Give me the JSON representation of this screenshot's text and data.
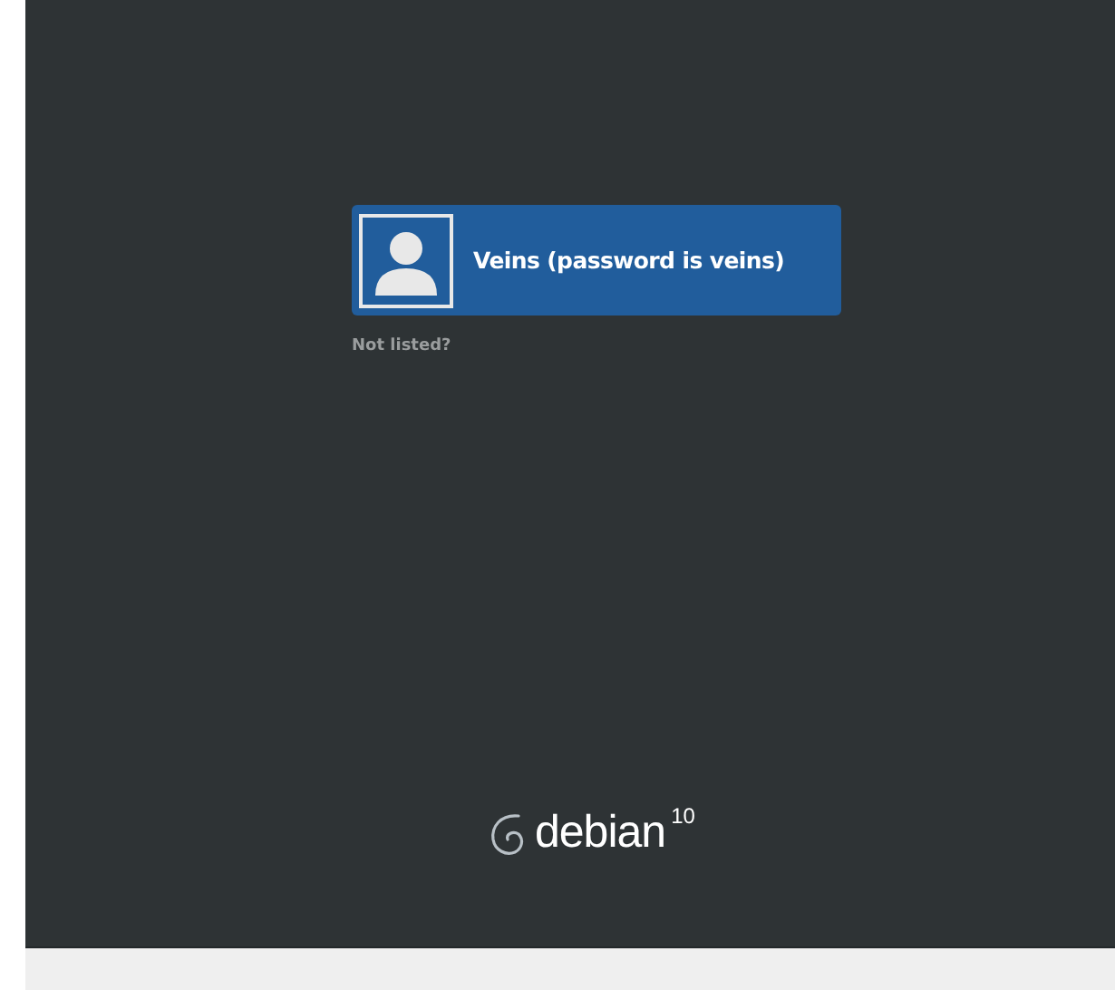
{
  "users": [
    {
      "name": "Veins (password is veins)",
      "selected": true
    }
  ],
  "not_listed": "Not listed?",
  "logo": {
    "wordmark": "debian",
    "version": "10"
  }
}
